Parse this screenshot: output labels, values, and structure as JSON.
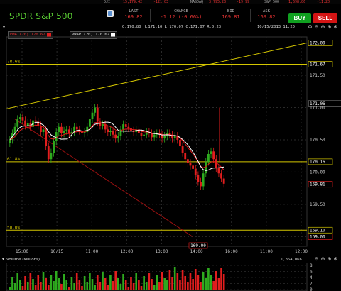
{
  "ticker_bar": [
    {
      "label": "DJI",
      "value": "15,179.42",
      "change": "-121.03"
    },
    {
      "label": "NASDAQ",
      "value": "3,795.20",
      "change": "-19.99"
    },
    {
      "label": "S&P 500",
      "value": "1,698.06",
      "change": "-11.20"
    }
  ],
  "header": {
    "title": "SPDR S&P 500",
    "last_label": "LAST",
    "last_value": "169.82",
    "change_label": "CHANGE",
    "change_value": "-1.12 (-0.66%)",
    "bid_label": "BID",
    "bid_value": "169.81",
    "ask_label": "ASK",
    "ask_value": "169.82",
    "buy_label": "BUY",
    "sell_label": "SELL"
  },
  "toolbar": {
    "ohlc": "O:170.80 H:171.10 L:170.07 C:171.07 R:0.23",
    "date": "10/15/2013 11:20"
  },
  "legend": {
    "ema": "EMA (20) 170.62",
    "vwap": "VWAP (20) 170.62"
  },
  "colors": {
    "up": "#2eaa1e",
    "down": "#e21e1e",
    "ema": "#e01818",
    "vwap": "#ffffff",
    "fib": "#d4c600",
    "accent": "#58c832",
    "negative": "#e63232"
  },
  "chart_data": {
    "type": "candlestick",
    "y_ticks": [
      "172.00",
      "171.50",
      "171.00",
      "170.50",
      "170.00",
      "169.50",
      "169.00"
    ],
    "x_ticks": [
      "15:00",
      "10/15",
      "11:00",
      "12:00",
      "13:00",
      "14:00",
      "16:00",
      "11:00",
      "12:00"
    ],
    "ylim": [
      168.85,
      172.05
    ],
    "price_tags": [
      "172.00",
      "171.67",
      "171.06",
      "170.16",
      "169.81",
      "169.10",
      "169.00"
    ],
    "fib_levels": [
      {
        "label": "78.6%",
        "price": 171.67
      },
      {
        "label": "61.8%",
        "price": 170.16
      },
      {
        "label": "50.0%",
        "price": 169.1
      }
    ],
    "closes": [
      170.5,
      170.6,
      170.7,
      170.82,
      170.85,
      170.8,
      170.72,
      170.76,
      170.7,
      170.8,
      170.78,
      170.72,
      170.62,
      170.66,
      170.4,
      170.2,
      170.3,
      170.48,
      170.62,
      170.7,
      170.6,
      170.64,
      170.66,
      170.6,
      170.62,
      170.7,
      170.66,
      170.64,
      170.6,
      170.62,
      170.7,
      170.82,
      170.92,
      171.0,
      170.78,
      170.72,
      170.74,
      170.66,
      170.62,
      170.64,
      170.58,
      170.52,
      170.56,
      170.66,
      170.74,
      170.7,
      170.68,
      170.64,
      170.62,
      170.66,
      170.6,
      170.56,
      170.58,
      170.62,
      170.6,
      170.54,
      170.58,
      170.6,
      170.58,
      170.52,
      170.56,
      170.6,
      170.58,
      170.52,
      170.56,
      170.5,
      170.4,
      170.3,
      170.2,
      170.14,
      170.1,
      170.05,
      169.95,
      169.85,
      169.78,
      169.98,
      170.16,
      170.28,
      170.32,
      170.2,
      170.06,
      169.98,
      169.9,
      169.82
    ],
    "volume_ticks": [
      "8",
      "6",
      "4",
      "2",
      "0"
    ],
    "volume_label": "Volume (Millions)",
    "volume_value": "1,864,066"
  }
}
